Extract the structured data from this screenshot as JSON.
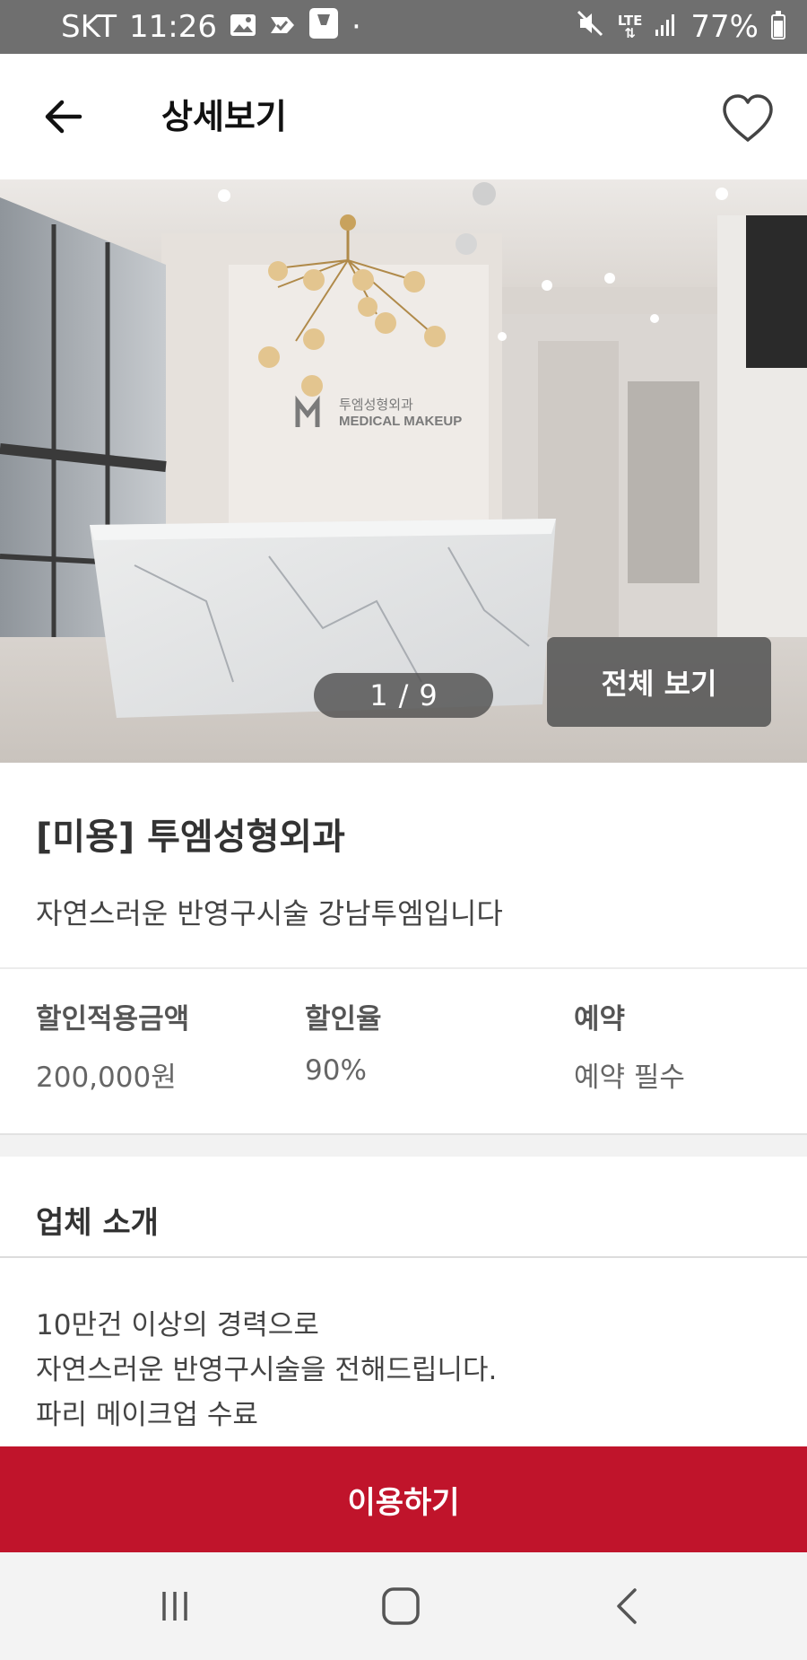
{
  "status_bar": {
    "carrier": "SKT",
    "time": "11:26",
    "badge": "멤버십",
    "dot": "·",
    "network": "LTE",
    "battery": "77%",
    "battery_level": 0.77
  },
  "app_bar": {
    "title": "상세보기"
  },
  "hero": {
    "sign_text_ko": "투엠성형외과",
    "sign_text_en": "MEDICAL MAKEUP",
    "current_page": "1",
    "separator": "/",
    "total_pages": "9",
    "view_all_label": "전체 보기"
  },
  "shop": {
    "title": "[미용] 투엠성형외과",
    "subtitle": "자연스러운 반영구시술 강남투엠입니다"
  },
  "stats": [
    {
      "label": "할인적용금액",
      "value": "200,000원"
    },
    {
      "label": "할인율",
      "value": "90%"
    },
    {
      "label": "예약",
      "value": "예약 필수"
    }
  ],
  "intro": {
    "title": "업체 소개",
    "lines": [
      "10만건 이상의 경력으로",
      "자연스러운 반영구시술을 전해드립니다.",
      "파리 메이크업 수료"
    ]
  },
  "cta": {
    "label": "이용하기"
  },
  "colors": {
    "accent": "#c0142b",
    "status_bar": "#6f6f6f"
  },
  "icons": [
    "image-icon",
    "check-icon",
    "app-badge-icon",
    "mute-icon",
    "signal-icon",
    "battery-icon",
    "back-arrow-icon",
    "heart-icon",
    "recents-icon",
    "home-icon",
    "nav-back-icon"
  ]
}
